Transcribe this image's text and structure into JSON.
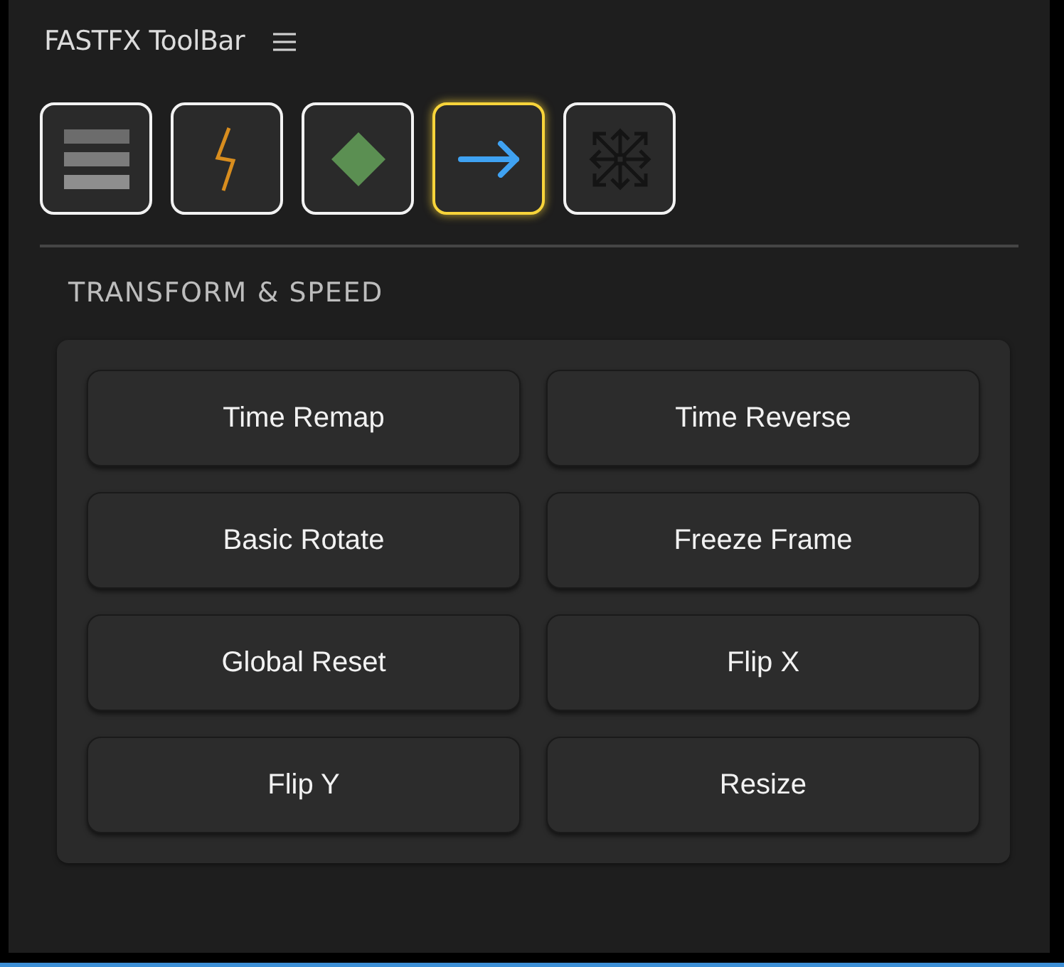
{
  "panel": {
    "title": "FASTFX ToolBar"
  },
  "tools": [
    {
      "kind": "bars",
      "selected": false
    },
    {
      "kind": "bolt",
      "selected": false
    },
    {
      "kind": "diamond",
      "selected": false
    },
    {
      "kind": "arrow",
      "selected": true
    },
    {
      "kind": "move",
      "selected": false
    }
  ],
  "section": {
    "title": "TRANSFORM & SPEED",
    "actions": [
      "Time Remap",
      "Time Reverse",
      "Basic Rotate",
      "Freeze Frame",
      "Global Reset",
      "Flip X",
      "Flip Y",
      "Resize"
    ]
  }
}
